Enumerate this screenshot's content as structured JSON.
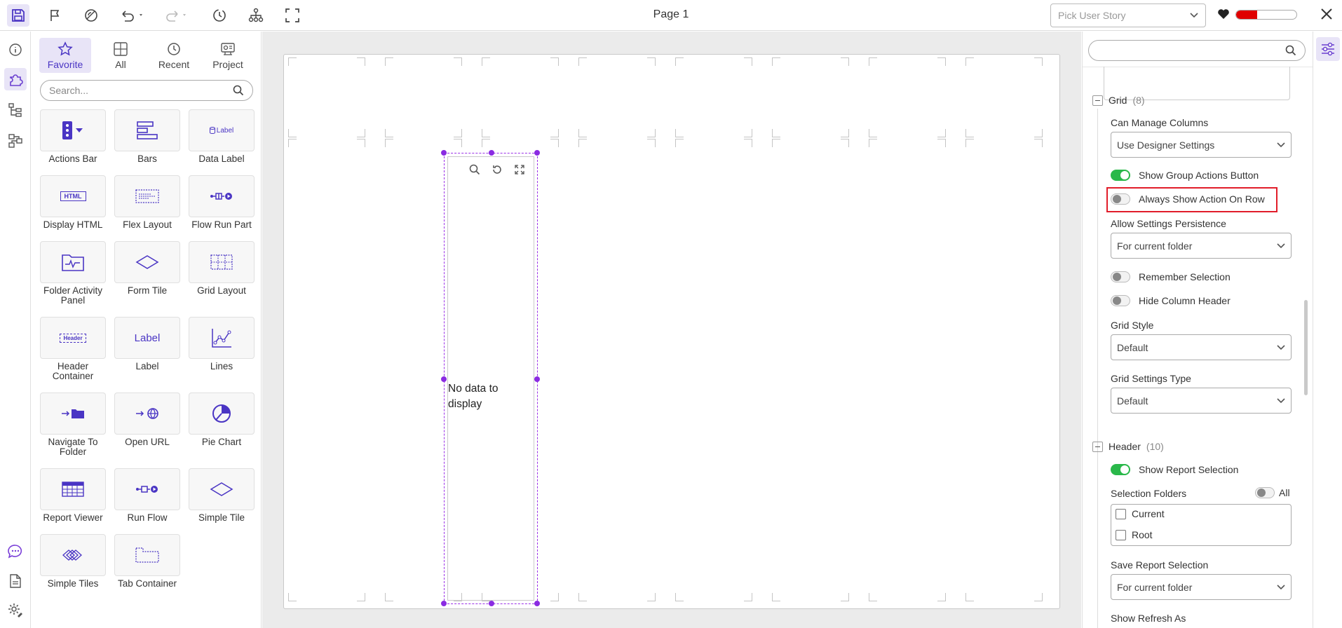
{
  "app": {
    "page_title": "Page 1",
    "story_placeholder": "Pick User Story",
    "health_level_pct": 35,
    "accent_color": "#4a35c4",
    "highlight_color": "#e11d2a",
    "toggle_on_color": "#2ab84a"
  },
  "toolbar": {
    "icons": [
      "save-icon",
      "flag-icon",
      "preview-icon",
      "undo-icon",
      "redo-icon",
      "history-icon",
      "hierarchy-icon",
      "fullscreen-icon"
    ]
  },
  "rail": {
    "icons": [
      "info-icon",
      "widgets-icon",
      "tree-icon",
      "flow-icon",
      "chat-icon",
      "document-icon",
      "settings-icon"
    ]
  },
  "palette": {
    "tabs": [
      {
        "label": "Favorite",
        "icon": "star-icon"
      },
      {
        "label": "All",
        "icon": "grid-icon"
      },
      {
        "label": "Recent",
        "icon": "clock-icon"
      },
      {
        "label": "Project",
        "icon": "project-icon"
      }
    ],
    "search_placeholder": "Search...",
    "tiles": [
      {
        "label": "Actions Bar"
      },
      {
        "label": "Bars"
      },
      {
        "label": "Data Label",
        "icon_text": "Label"
      },
      {
        "label": "Display HTML",
        "icon_text": "HTML"
      },
      {
        "label": "Flex Layout"
      },
      {
        "label": "Flow Run Part"
      },
      {
        "label": "Folder Activity Panel"
      },
      {
        "label": "Form Tile"
      },
      {
        "label": "Grid Layout"
      },
      {
        "label": "Header Container",
        "icon_text": "Header"
      },
      {
        "label": "Label",
        "icon_text": "Label"
      },
      {
        "label": "Lines"
      },
      {
        "label": "Navigate To Folder"
      },
      {
        "label": "Open URL"
      },
      {
        "label": "Pie Chart"
      },
      {
        "label": "Report Viewer"
      },
      {
        "label": "Run Flow"
      },
      {
        "label": "Simple Tile"
      },
      {
        "label": "Simple Tiles"
      },
      {
        "label": "Tab Container"
      }
    ]
  },
  "canvas": {
    "no_data_text": "No data to display"
  },
  "props": {
    "grid": {
      "title": "Grid",
      "count": "(8)",
      "can_manage_columns_label": "Can Manage Columns",
      "can_manage_columns_value": "Use Designer Settings",
      "show_group_actions_label": "Show Group Actions Button",
      "always_show_action_label": "Always Show Action On Row",
      "allow_persistence_label": "Allow Settings Persistence",
      "allow_persistence_value": "For current folder",
      "remember_selection_label": "Remember Selection",
      "hide_column_header_label": "Hide Column Header",
      "grid_style_label": "Grid Style",
      "grid_style_value": "Default",
      "grid_settings_type_label": "Grid Settings Type",
      "grid_settings_type_value": "Default"
    },
    "header": {
      "title": "Header",
      "count": "(10)",
      "show_report_selection_label": "Show Report Selection",
      "selection_folders_label": "Selection Folders",
      "all_label": "All",
      "current_label": "Current",
      "root_label": "Root",
      "save_report_selection_label": "Save Report Selection",
      "save_report_selection_value": "For current folder",
      "show_refresh_as_label": "Show Refresh As"
    }
  }
}
